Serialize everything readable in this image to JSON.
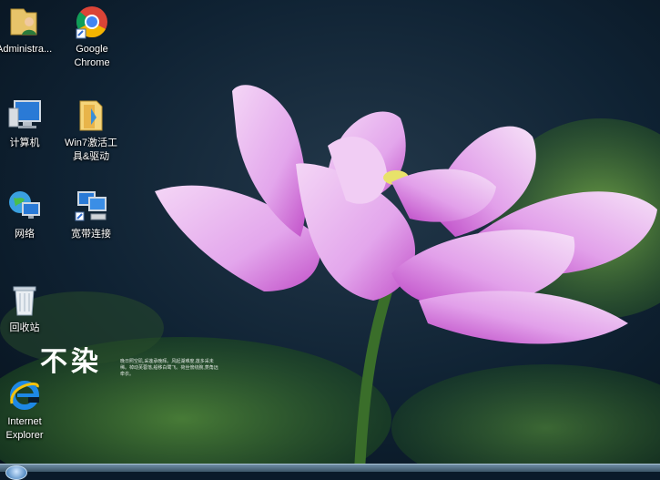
{
  "desktop": {
    "icons": [
      {
        "label": "Administra..."
      },
      {
        "label": "Google\nChrome"
      },
      {
        "label": "计算机"
      },
      {
        "label": "Win7激活工\n具&驱动"
      },
      {
        "label": "网络"
      },
      {
        "label": "宽带连接"
      },
      {
        "label": "回收站"
      },
      {
        "label": "Internet\nExplorer"
      }
    ]
  },
  "wallpaper": {
    "title_text": "不染",
    "poem_text": "晚日照空矶,采莲承晚晖。风起湖难度,莲多采未稀。棹动芙蓉落,船移白鹭飞。荷丝傍绕腕,菱角远牵衣。"
  }
}
